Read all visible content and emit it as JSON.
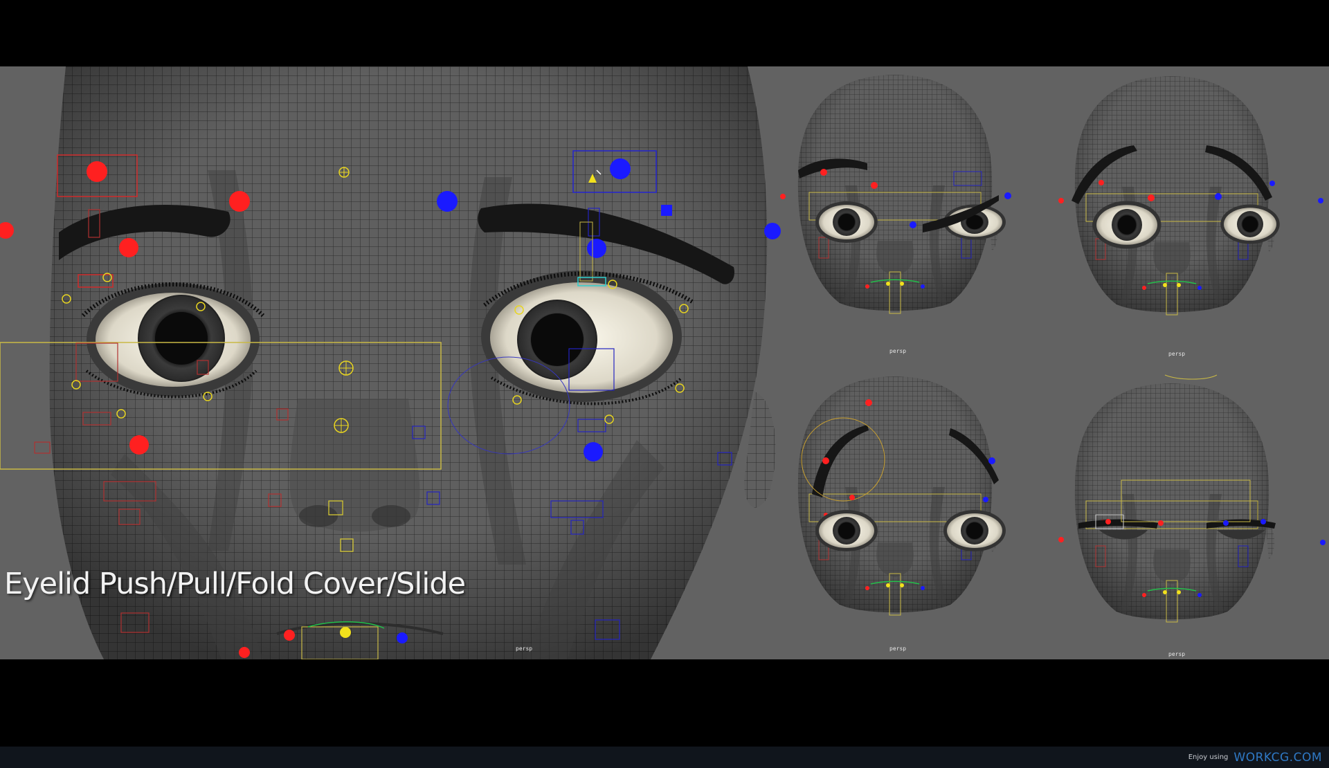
{
  "caption": {
    "title": "Eyelid Push/Pull/Fold Cover/Slide"
  },
  "viewports": {
    "main_label": "persp",
    "thumb_labels": [
      "persp",
      "persp",
      "persp",
      "persp"
    ]
  },
  "footer": {
    "prefix": "Enjoy using",
    "brand": "WORKCG.COM"
  },
  "colors": {
    "viewport_bg": "#626262",
    "mesh": "#5d5d5d",
    "wire": "#2a2a2a",
    "control_red": "#ff2020",
    "control_blue": "#1a1aff",
    "control_yellow": "#f2e11c",
    "brand": "#2f79c5"
  },
  "icons": [
    "control-red-dot",
    "control-blue-dot",
    "control-yellow-target",
    "pivot-cursor-icon"
  ]
}
